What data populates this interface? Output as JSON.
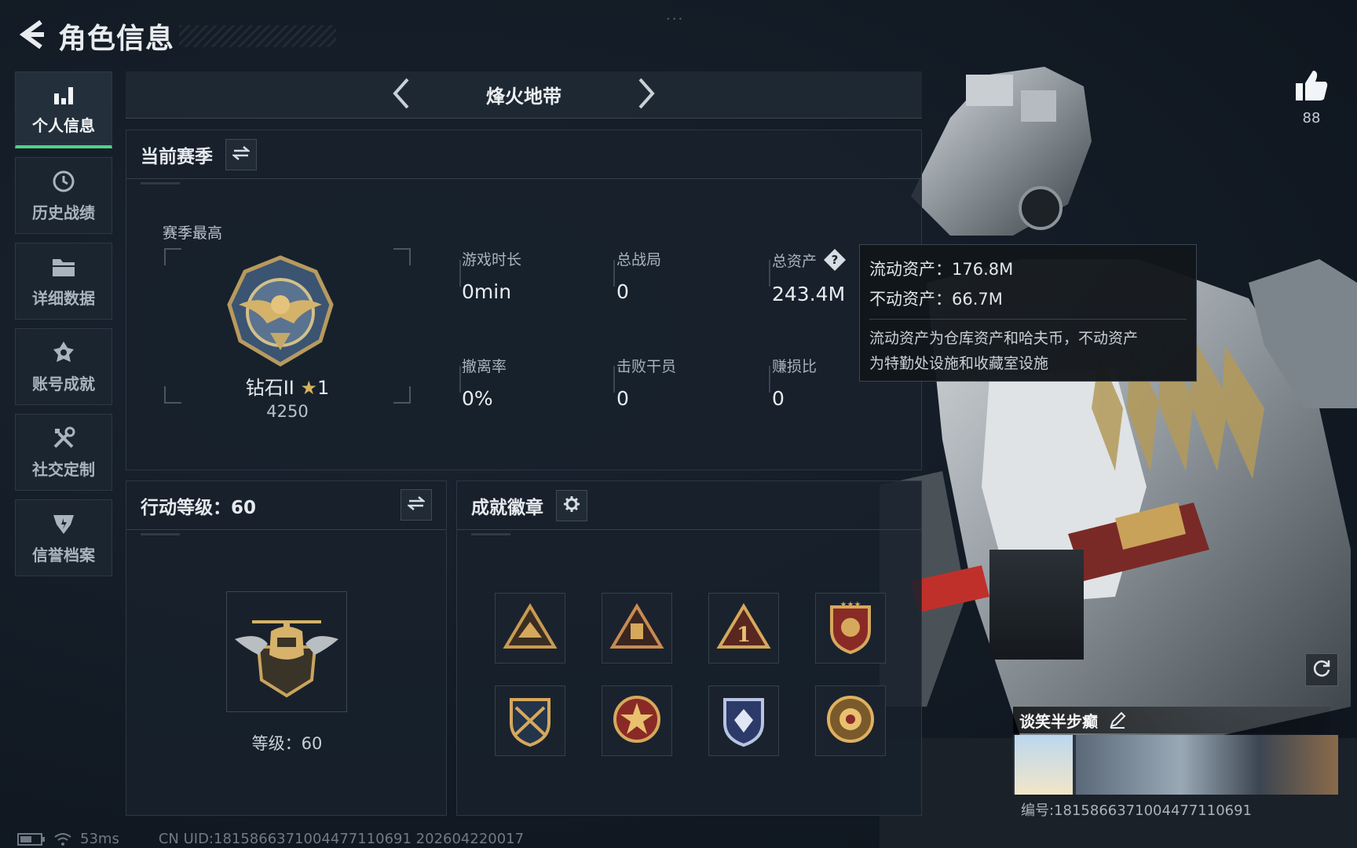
{
  "header": {
    "title": "角色信息",
    "back_icon": "back-arrow-icon"
  },
  "top_dots": "···",
  "sidebar": {
    "items": [
      {
        "label": "个人信息",
        "icon": "bar-chart-icon",
        "active": true
      },
      {
        "label": "历史战绩",
        "icon": "history-clock-icon",
        "active": false
      },
      {
        "label": "详细数据",
        "icon": "folder-icon",
        "active": false
      },
      {
        "label": "账号成就",
        "icon": "achievement-icon",
        "active": false
      },
      {
        "label": "社交定制",
        "icon": "tools-icon",
        "active": false
      },
      {
        "label": "信誉档案",
        "icon": "shield-emblem-icon",
        "active": false
      }
    ],
    "active_color": "#4fd28a"
  },
  "mode": {
    "title": "烽火地带"
  },
  "season": {
    "title": "当前赛季",
    "best_label": "赛季最高",
    "rank_name": "钻石II",
    "rank_stars": "1",
    "rank_score": "4250",
    "stats": {
      "play_time": {
        "label": "游戏时长",
        "value": "0min"
      },
      "total_games": {
        "label": "总战局",
        "value": "0"
      },
      "total_assets": {
        "label": "总资产",
        "value": "243.4M"
      },
      "extract_rate": {
        "label": "撤离率",
        "value": "0%"
      },
      "kills": {
        "label": "击败干员",
        "value": "0"
      },
      "profit_ratio": {
        "label": "赚损比",
        "value": "0"
      }
    }
  },
  "tooltip": {
    "liquid": "流动资产：176.8M",
    "fixed": "不动资产：66.7M",
    "desc_line1": "流动资产为仓库资产和哈夫币，不动资产",
    "desc_line2": "为特勤处设施和收藏室设施"
  },
  "level": {
    "title": "行动等级：60",
    "level_text": "等级：60"
  },
  "achievements": {
    "title": "成就徽章",
    "badges": [
      "tent-triangle-badge",
      "robot-triangle-badge",
      "number-one-triangle-badge",
      "star-shield-badge",
      "crossed-rifles-badge",
      "star-wreath-badge",
      "diamond-shield-badge",
      "flower-wreath-badge"
    ]
  },
  "like": {
    "count": "88"
  },
  "player": {
    "name": "谈笑半步癫",
    "id_text": "编号:1815866371004477110691"
  },
  "footer": {
    "ping": "53ms",
    "uid": "CN UID:1815866371004477110691 202604220017"
  }
}
